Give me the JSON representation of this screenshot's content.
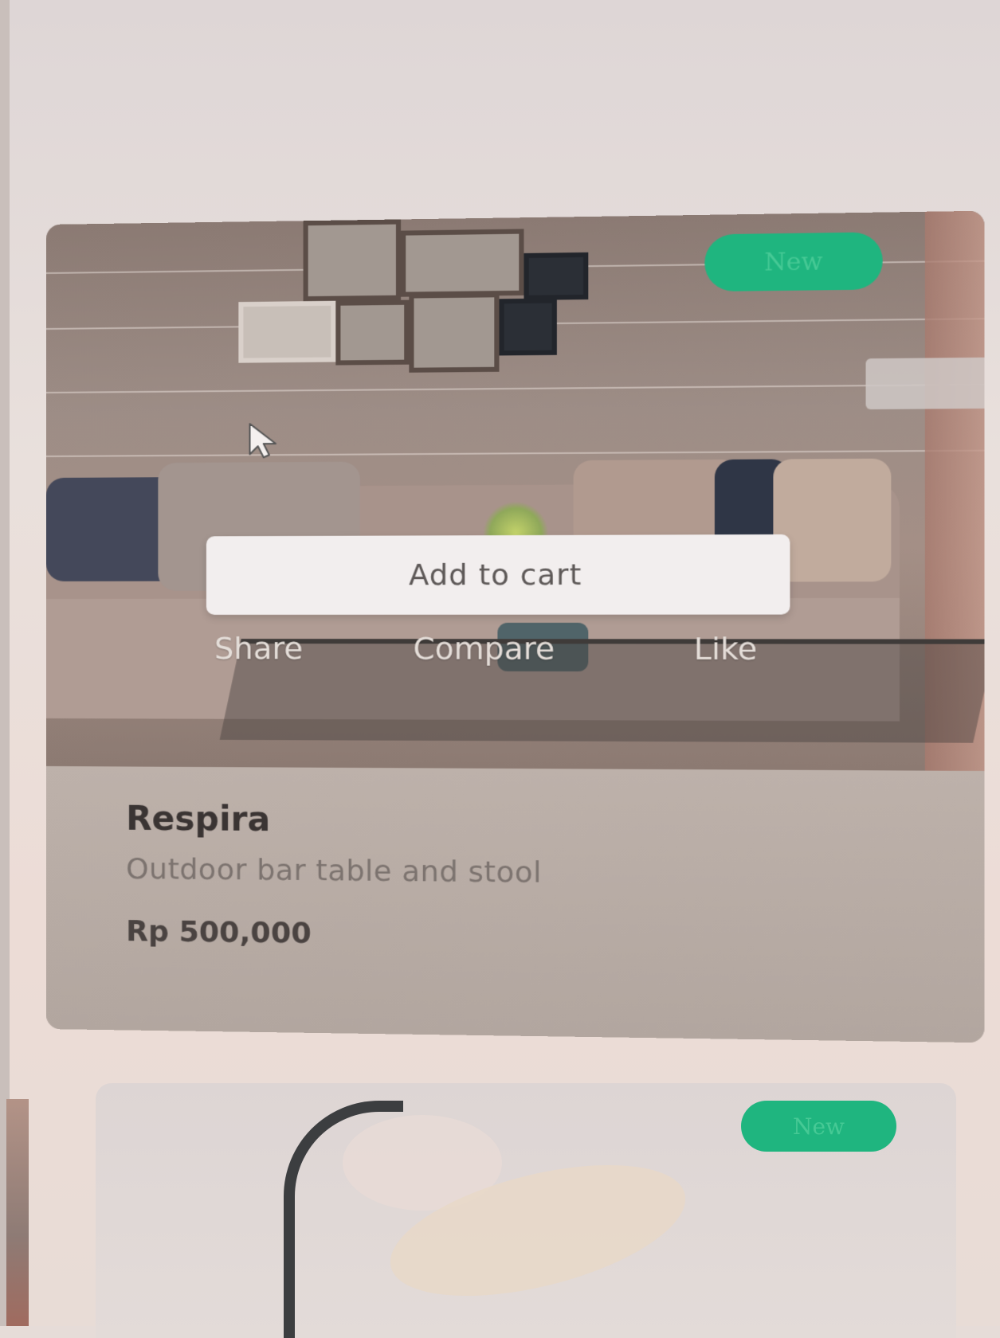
{
  "product_card": {
    "badge": "New",
    "actions": {
      "add_to_cart": "Add to cart",
      "share": "Share",
      "compare": "Compare",
      "like": "Like"
    },
    "name": "Respira",
    "description": "Outdoor bar table and stool",
    "price": "Rp 500,000",
    "image_icon": "living-room-photo"
  },
  "next_card": {
    "badge": "New",
    "image_icon": "floor-lamp-photo"
  },
  "colors": {
    "badge_green": "#1fb57f",
    "button_bg": "#f2eeee",
    "card_info_bg": "#b8aca6"
  }
}
